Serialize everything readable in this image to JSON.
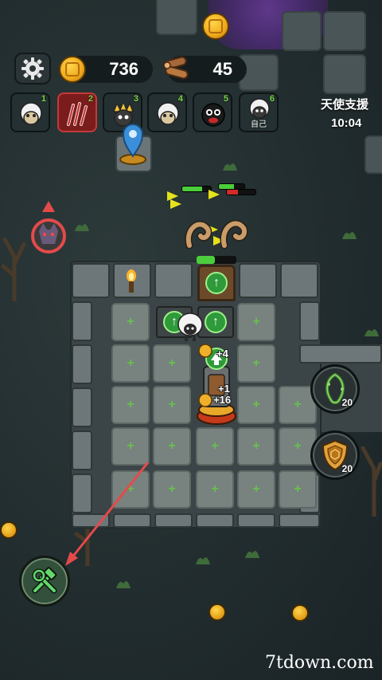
{
  "hud": {
    "settings_icon": "gear-icon",
    "gold": "736",
    "wood": "45"
  },
  "players": [
    {
      "slot": "1",
      "icon": "sheep-icon"
    },
    {
      "slot": "2",
      "icon": "claw-monster-icon",
      "selected": true
    },
    {
      "slot": "3",
      "icon": "spiky-hair-sheep-icon"
    },
    {
      "slot": "4",
      "icon": "sheep-icon"
    },
    {
      "slot": "5",
      "icon": "black-monster-icon"
    },
    {
      "slot": "6",
      "icon": "sheep-icon",
      "label": "自己"
    }
  ],
  "support": {
    "label": "天使支援",
    "timer": "10:04"
  },
  "room": {
    "tower_bonuses": [
      "+4",
      "+1",
      "+16"
    ]
  },
  "skills": [
    {
      "icon": "vine-shield-icon",
      "count": "20"
    },
    {
      "icon": "armor-shield-icon",
      "count": "20"
    }
  ],
  "build_button_icon": "hammer-wrench-icon",
  "watermark": "7tdown.com",
  "colors": {
    "accent_green": "#4ccd3c",
    "hp_red": "#d42a2a",
    "selected_slot": "#7a1c1c",
    "pointer_arrow": "#e44a4a"
  }
}
